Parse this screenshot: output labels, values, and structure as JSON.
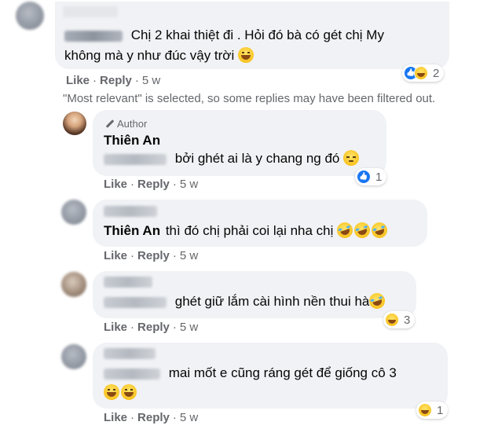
{
  "comments": [
    {
      "line1": "Chị 2 khai thiệt đi . Hỏi đó bà có gét chị My",
      "line2": "không mà y như đúc vậy trời",
      "actions": {
        "like": "Like",
        "reply": "Reply",
        "time": "5 w"
      },
      "reactions": {
        "count": "2",
        "icons": [
          "like-icon",
          "haha-icon"
        ]
      }
    }
  ],
  "filter_note": "\"Most relevant\" is selected, so some replies may have been filtered out.",
  "replies": [
    {
      "author_badge": "Author",
      "name": "Thiên An",
      "text": "bởi ghét ai là y chang ng đó",
      "actions": {
        "like": "Like",
        "reply": "Reply",
        "time": "5 w"
      },
      "reactions": {
        "count": "1",
        "icons": [
          "like-icon"
        ]
      }
    },
    {
      "mention": "Thiên An",
      "text": "thì đó chị phải coi lại nha chị",
      "actions": {
        "like": "Like",
        "reply": "Reply",
        "time": "5 w"
      }
    },
    {
      "text": "ghét giữ lắm cài hình nền thui hà",
      "actions": {
        "like": "Like",
        "reply": "Reply",
        "time": "5 w"
      },
      "reactions": {
        "count": "3",
        "icons": [
          "haha-icon"
        ]
      }
    },
    {
      "text": "mai mốt e cũng ráng gét để giống cô 3",
      "actions": {
        "like": "Like",
        "reply": "Reply",
        "time": "5 w"
      },
      "reactions": {
        "count": "1",
        "icons": [
          "haha-icon"
        ]
      }
    }
  ]
}
